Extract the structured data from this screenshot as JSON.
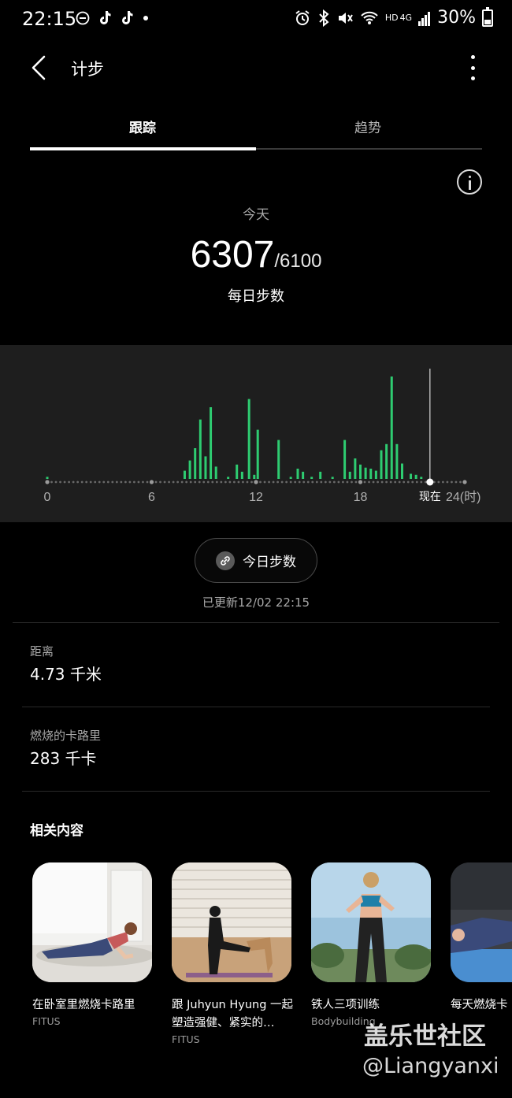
{
  "status_bar": {
    "time": "22:15",
    "network_hd": "HD",
    "network_gen": "4G",
    "battery": "30%",
    "battery_level": 0.3
  },
  "header": {
    "title": "计步"
  },
  "tabs": [
    {
      "label": "跟踪",
      "active": true
    },
    {
      "label": "趋势",
      "active": false
    }
  ],
  "summary": {
    "day_label": "今天",
    "steps": "6307",
    "goal": "/6100",
    "caption": "每日步数"
  },
  "chart_data": {
    "type": "bar",
    "x_ticks": [
      "0",
      "6",
      "12",
      "18",
      "24(时)"
    ],
    "now_label": "现在",
    "xlim": [
      0,
      24
    ],
    "now_hour": 22,
    "bars": [
      {
        "x": 0.0,
        "v": 2
      },
      {
        "x": 7.9,
        "v": 8
      },
      {
        "x": 8.2,
        "v": 18
      },
      {
        "x": 8.5,
        "v": 30
      },
      {
        "x": 8.8,
        "v": 58
      },
      {
        "x": 9.1,
        "v": 22
      },
      {
        "x": 9.4,
        "v": 70
      },
      {
        "x": 9.7,
        "v": 12
      },
      {
        "x": 10.4,
        "v": 2
      },
      {
        "x": 10.9,
        "v": 14
      },
      {
        "x": 11.2,
        "v": 7
      },
      {
        "x": 11.6,
        "v": 78
      },
      {
        "x": 11.9,
        "v": 4
      },
      {
        "x": 12.1,
        "v": 48
      },
      {
        "x": 13.3,
        "v": 38
      },
      {
        "x": 14.0,
        "v": 2
      },
      {
        "x": 14.4,
        "v": 10
      },
      {
        "x": 14.7,
        "v": 7
      },
      {
        "x": 15.2,
        "v": 2
      },
      {
        "x": 15.7,
        "v": 7
      },
      {
        "x": 16.4,
        "v": 2
      },
      {
        "x": 17.1,
        "v": 38
      },
      {
        "x": 17.4,
        "v": 7
      },
      {
        "x": 17.7,
        "v": 20
      },
      {
        "x": 18.0,
        "v": 14
      },
      {
        "x": 18.3,
        "v": 11
      },
      {
        "x": 18.6,
        "v": 10
      },
      {
        "x": 18.9,
        "v": 8
      },
      {
        "x": 19.2,
        "v": 28
      },
      {
        "x": 19.5,
        "v": 34
      },
      {
        "x": 19.8,
        "v": 100
      },
      {
        "x": 20.1,
        "v": 34
      },
      {
        "x": 20.4,
        "v": 15
      },
      {
        "x": 20.9,
        "v": 5
      },
      {
        "x": 21.2,
        "v": 4
      },
      {
        "x": 21.5,
        "v": 2
      }
    ],
    "bar_color": "#2ecc71"
  },
  "today_button": {
    "label": "今日步数"
  },
  "updated": "已更新12/02 22:15",
  "stats": [
    {
      "label": "距离",
      "value": "4.73 千米"
    },
    {
      "label": "燃烧的卡路里",
      "value": "283 千卡"
    }
  ],
  "related": {
    "title": "相关内容",
    "items": [
      {
        "title": "在卧室里燃烧卡路里",
        "source": "FITUS"
      },
      {
        "title": "跟 Juhyun Hyung 一起塑造强健、紧实的…",
        "source": "FITUS"
      },
      {
        "title": "铁人三项训练",
        "source": "Bodybuilding"
      },
      {
        "title": "每天燃烧卡",
        "source": ""
      }
    ]
  },
  "watermark": {
    "line1": "盖乐世社区",
    "line2": "@Liangyanxi"
  }
}
